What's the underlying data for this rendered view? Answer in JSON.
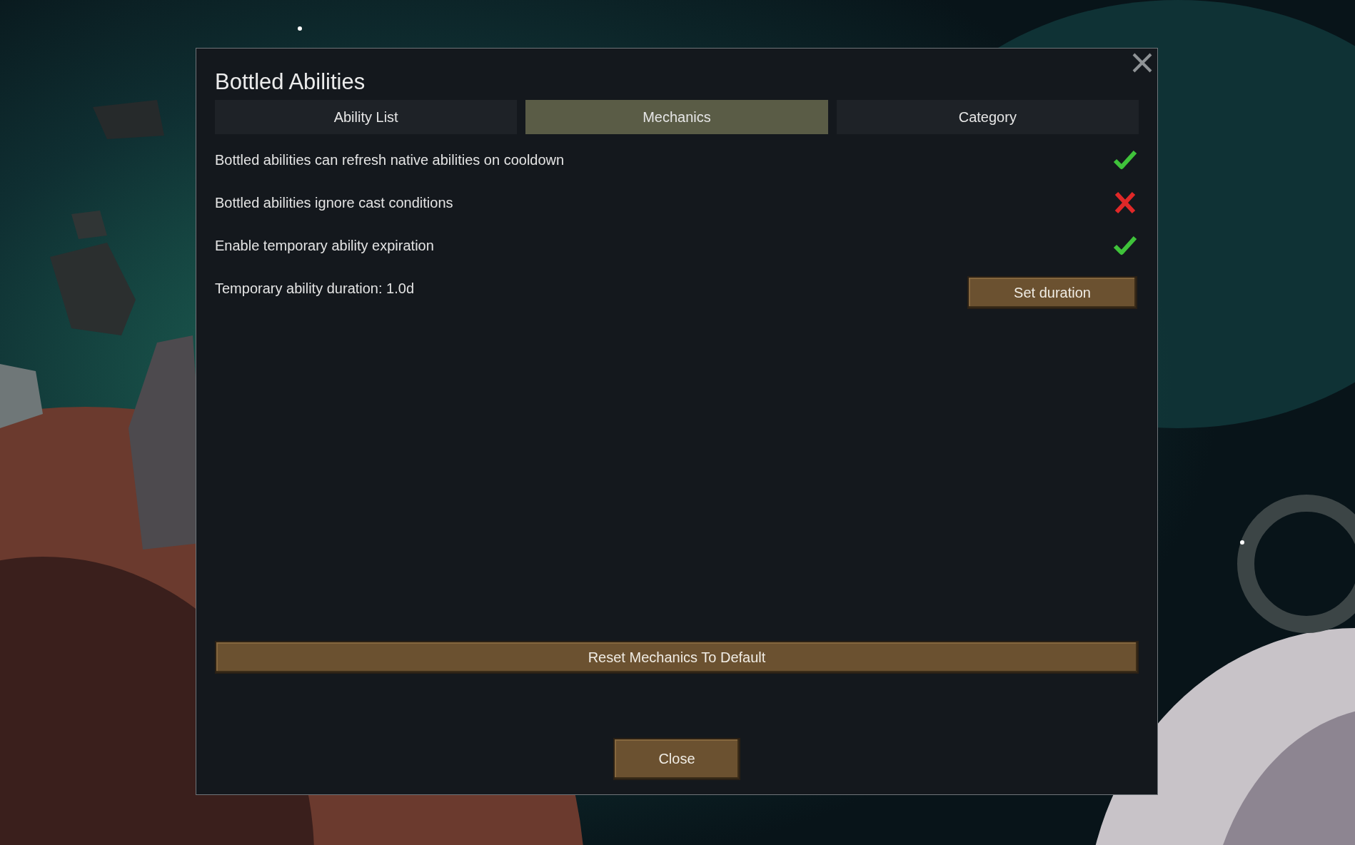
{
  "dialog": {
    "title": "Bottled Abilities",
    "tabs": [
      {
        "label": "Ability List",
        "selected": false
      },
      {
        "label": "Mechanics",
        "selected": true
      },
      {
        "label": "Category",
        "selected": false
      }
    ],
    "settings": [
      {
        "kind": "toggle",
        "label": "Bottled abilities can refresh native abilities on cooldown",
        "checked": true
      },
      {
        "kind": "toggle",
        "label": "Bottled abilities ignore cast conditions",
        "checked": false
      },
      {
        "kind": "toggle",
        "label": "Enable temporary ability expiration",
        "checked": true
      },
      {
        "kind": "action",
        "label": "Temporary ability duration: 1.0d",
        "button": "Set duration"
      }
    ],
    "reset_button": "Reset Mechanics To Default",
    "close_button": "Close"
  }
}
